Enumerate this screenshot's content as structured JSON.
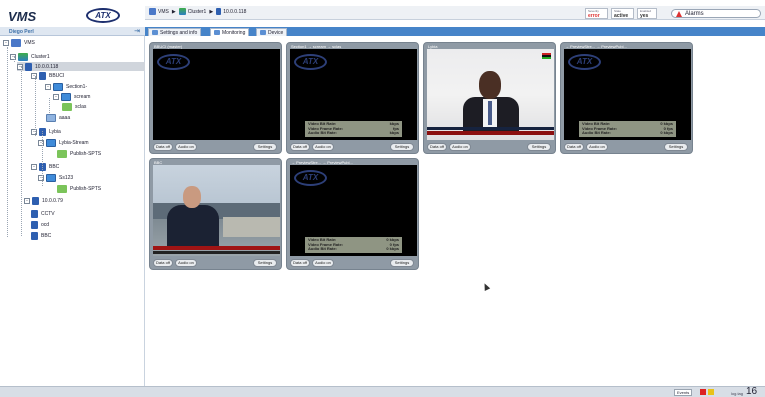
{
  "header": {
    "app_title": "VMS",
    "logo_text": "ATX",
    "user_name": "Diego Perl"
  },
  "breadcrumb": {
    "items": [
      "VMS",
      "Cluster1",
      "10.0.0.118"
    ]
  },
  "status": [
    {
      "key": "Severity",
      "value": "error",
      "color": "#d33"
    },
    {
      "key": "State",
      "value": "active",
      "color": "#333"
    },
    {
      "key": "Enabled",
      "value": "yes",
      "color": "#333"
    }
  ],
  "alarms_label": "Alarms",
  "tabs": [
    "Settings and info",
    "Monitoring",
    "Device"
  ],
  "tree": [
    {
      "label": "VMS",
      "expander": "-",
      "icon": "ico-group"
    },
    {
      "label": "Cluster1",
      "expander": "-",
      "icon": "ico-site"
    },
    {
      "label": "10.0.0.118",
      "expander": "-",
      "icon": "ico-server"
    },
    {
      "label": "BBUCI",
      "expander": "-",
      "icon": "ico-server"
    },
    {
      "label": "Section1-",
      "expander": "-",
      "icon": "ico-channel"
    },
    {
      "label": "scream",
      "expander": "-",
      "icon": "ico-channel"
    },
    {
      "label": "sclas",
      "expander": "",
      "icon": "ico-stream"
    },
    {
      "label": "aaaa",
      "expander": "",
      "icon": "ico-src"
    },
    {
      "label": "Lybia",
      "expander": "-",
      "icon": "ico-server"
    },
    {
      "label": "Lybia-Stream",
      "expander": "-",
      "icon": "ico-channel"
    },
    {
      "label": "Publish-SPTS",
      "expander": "",
      "icon": "ico-stream"
    },
    {
      "label": "BBC",
      "expander": "-",
      "icon": "ico-server"
    },
    {
      "label": "Ss123",
      "expander": "-",
      "icon": "ico-channel"
    },
    {
      "label": "Publish-SPTS",
      "expander": "",
      "icon": "ico-stream"
    },
    {
      "label": "10.0.0.79",
      "expander": "-",
      "icon": "ico-server"
    },
    {
      "label": "CCTV",
      "expander": "",
      "icon": "ico-server"
    },
    {
      "label": "ocd",
      "expander": "",
      "icon": "ico-server"
    },
    {
      "label": "BBC",
      "expander": "",
      "icon": "ico-server"
    }
  ],
  "tiles": [
    {
      "title": "BBUCI (master)",
      "scene": "atx",
      "stats": null
    },
    {
      "title": "Section1 → scream → sclas",
      "scene": "atx",
      "stats": [
        [
          "Video Bit Rate:",
          "kbps"
        ],
        [
          "Video Frame Rate:",
          "fps"
        ],
        [
          "Audio Bit Rate:",
          "kbps"
        ]
      ]
    },
    {
      "title": "Lybia",
      "scene": "person",
      "stats": null
    },
    {
      "title": "→ PreviewStre... → PreviewPubl...",
      "scene": "atx",
      "stats": [
        [
          "Video Bit Rate:",
          "0  kbps"
        ],
        [
          "Video Frame Rate:",
          "0  fps"
        ],
        [
          "Audio Bit Rate:",
          "0  kbps"
        ]
      ]
    },
    {
      "title": "BBC",
      "scene": "news",
      "stats": null
    },
    {
      "title": "→ PreviewStre... → PreviewPubl...",
      "scene": "atx",
      "stats": [
        [
          "Video Bit Rate:",
          "0  kbps"
        ],
        [
          "Video Frame Rate:",
          "0  fps"
        ],
        [
          "Audio Bit Rate:",
          "0  kbps"
        ]
      ]
    }
  ],
  "tile_buttons": {
    "data": "Data off",
    "audio": "Audio on",
    "settings": "Settings"
  },
  "footer": {
    "events_label": "Events",
    "tag_label": "log.tag",
    "counter": "16"
  },
  "colors": {
    "accent": "#4684c9",
    "tile_bg": "#8f9aa5"
  }
}
